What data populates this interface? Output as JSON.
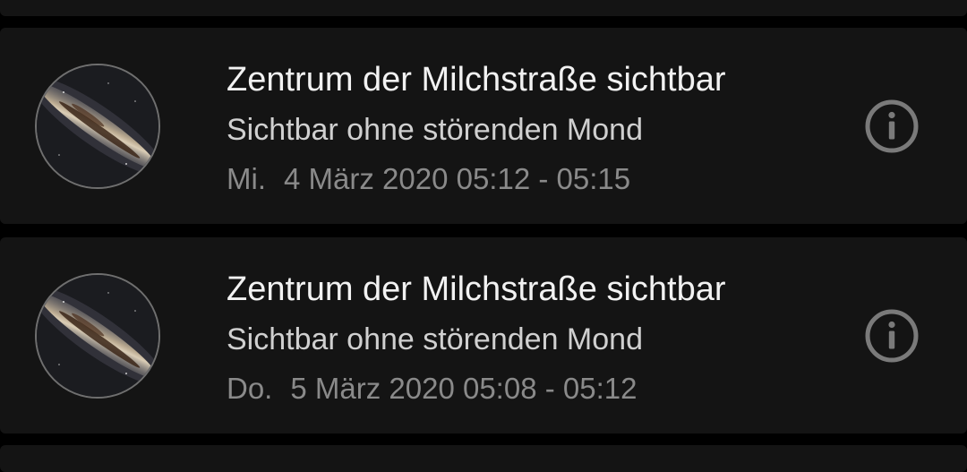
{
  "events": [
    {
      "title": "Zentrum der Milchstraße sichtbar",
      "subtitle": "Sichtbar ohne störenden Mond",
      "day": "Mi.",
      "date_time": "4 März 2020 05:12 - 05:15",
      "thumbnail_icon": "milky-way-core-image",
      "action_icon": "info-icon"
    },
    {
      "title": "Zentrum der Milchstraße sichtbar",
      "subtitle": "Sichtbar ohne störenden Mond",
      "day": "Do.",
      "date_time": "5 März 2020 05:08 - 05:12",
      "thumbnail_icon": "milky-way-core-image",
      "action_icon": "info-icon"
    }
  ],
  "colors": {
    "background": "#000000",
    "card": "#141414",
    "title": "#f2f2f2",
    "subtitle": "#d0d0d0",
    "date": "#8a8a8a",
    "icon": "#7a7a7a"
  }
}
